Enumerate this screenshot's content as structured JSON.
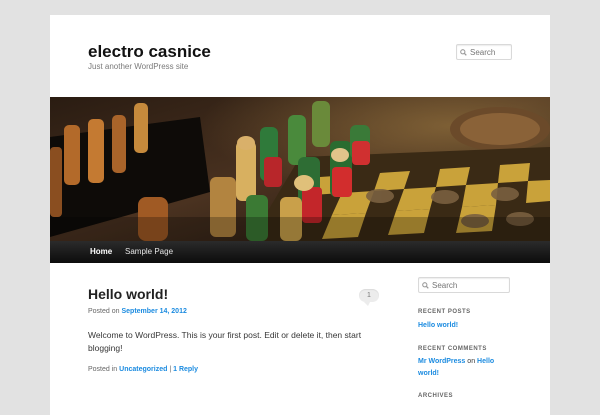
{
  "header": {
    "site_title": "electro casnice",
    "site_description": "Just another WordPress site",
    "search_placeholder": "Search"
  },
  "banner": {
    "icon": "chess-board-photo"
  },
  "nav": {
    "items": [
      {
        "label": "Home",
        "active": true
      },
      {
        "label": "Sample Page",
        "active": false
      }
    ]
  },
  "post": {
    "title": "Hello world!",
    "comment_count": "1",
    "posted_on": "Posted on",
    "date": "September 14, 2012",
    "content": "Welcome to WordPress. This is your first post. Edit or delete it, then start blogging!",
    "posted_in": "Posted in",
    "category": "Uncategorized",
    "separator": "|",
    "reply": "1 Reply"
  },
  "sidebar": {
    "search_placeholder": "Search",
    "recent_posts_title": "Recent Posts",
    "recent_posts": [
      "Hello world!"
    ],
    "recent_comments_title": "Recent Comments",
    "comment_author": "Mr WordPress",
    "comment_on": "on",
    "comment_post": "Hello world!",
    "archives_title": "Archives"
  },
  "colors": {
    "background": "#e2e2e2",
    "page": "#ffffff",
    "link": "#1b8be0",
    "nav_bar": "#1a1a1a"
  }
}
